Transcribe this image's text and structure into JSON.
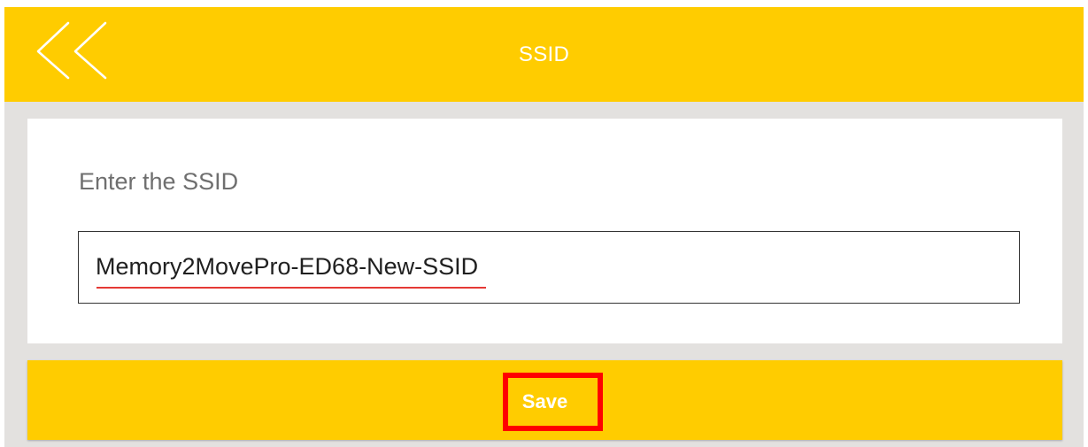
{
  "app": {
    "accent_color": "#ffcc00",
    "header_text_color": "#ffffff",
    "highlight_color": "#ff0000"
  },
  "header": {
    "back_icon": "double-chevron-left-icon",
    "title": "SSID"
  },
  "form": {
    "label": "Enter the SSID",
    "ssid_value": "Memory2MovePro-ED68-New-SSID"
  },
  "actions": {
    "save_label": "Save"
  }
}
